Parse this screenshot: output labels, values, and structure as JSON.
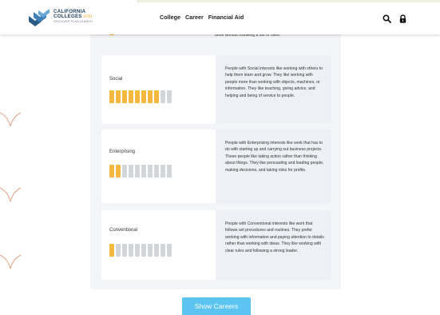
{
  "header": {
    "logo": {
      "line1": "CALIFORNIA",
      "line2": "COLLEGES",
      "line2_suffix": ".edu",
      "tagline": "DISCOVER PLAN LAUNCH"
    },
    "nav": [
      "College",
      "Career",
      "Financial Aid"
    ],
    "icons": [
      "search-icon",
      "lock-icon"
    ]
  },
  "partial": {
    "desc": "done without following a set of rules."
  },
  "cards": [
    {
      "title": "Social",
      "score": 8,
      "max": 10,
      "desc": "People with Social interests like working with others to help them learn and grow. They like working with people more than working with objects, machines, or information. They like teaching, giving advice, and helping and being of service to people."
    },
    {
      "title": "Enterprising",
      "score": 2,
      "max": 10,
      "desc": "People with Enterprising interests like work that has to do with starting up and carrying out business projects. These people like taking action rather than thinking about things. They like persuading and leading people, making decisions, and taking risks for profits."
    },
    {
      "title": "Conventional",
      "score": 1,
      "max": 10,
      "desc": "People with Conventional interests like work that follows set procedures and routines. They prefer working with information and paying attention to details rather than working with ideas. They like working with clear rules and following a strong leader."
    }
  ],
  "show_careers": "Show Careers",
  "colors": {
    "bar_on": "#f4b73f",
    "bar_off": "#d3d6d9",
    "button": "#5cc4f0",
    "brand": "#1f3d5c",
    "accent": "#f4b73f"
  }
}
